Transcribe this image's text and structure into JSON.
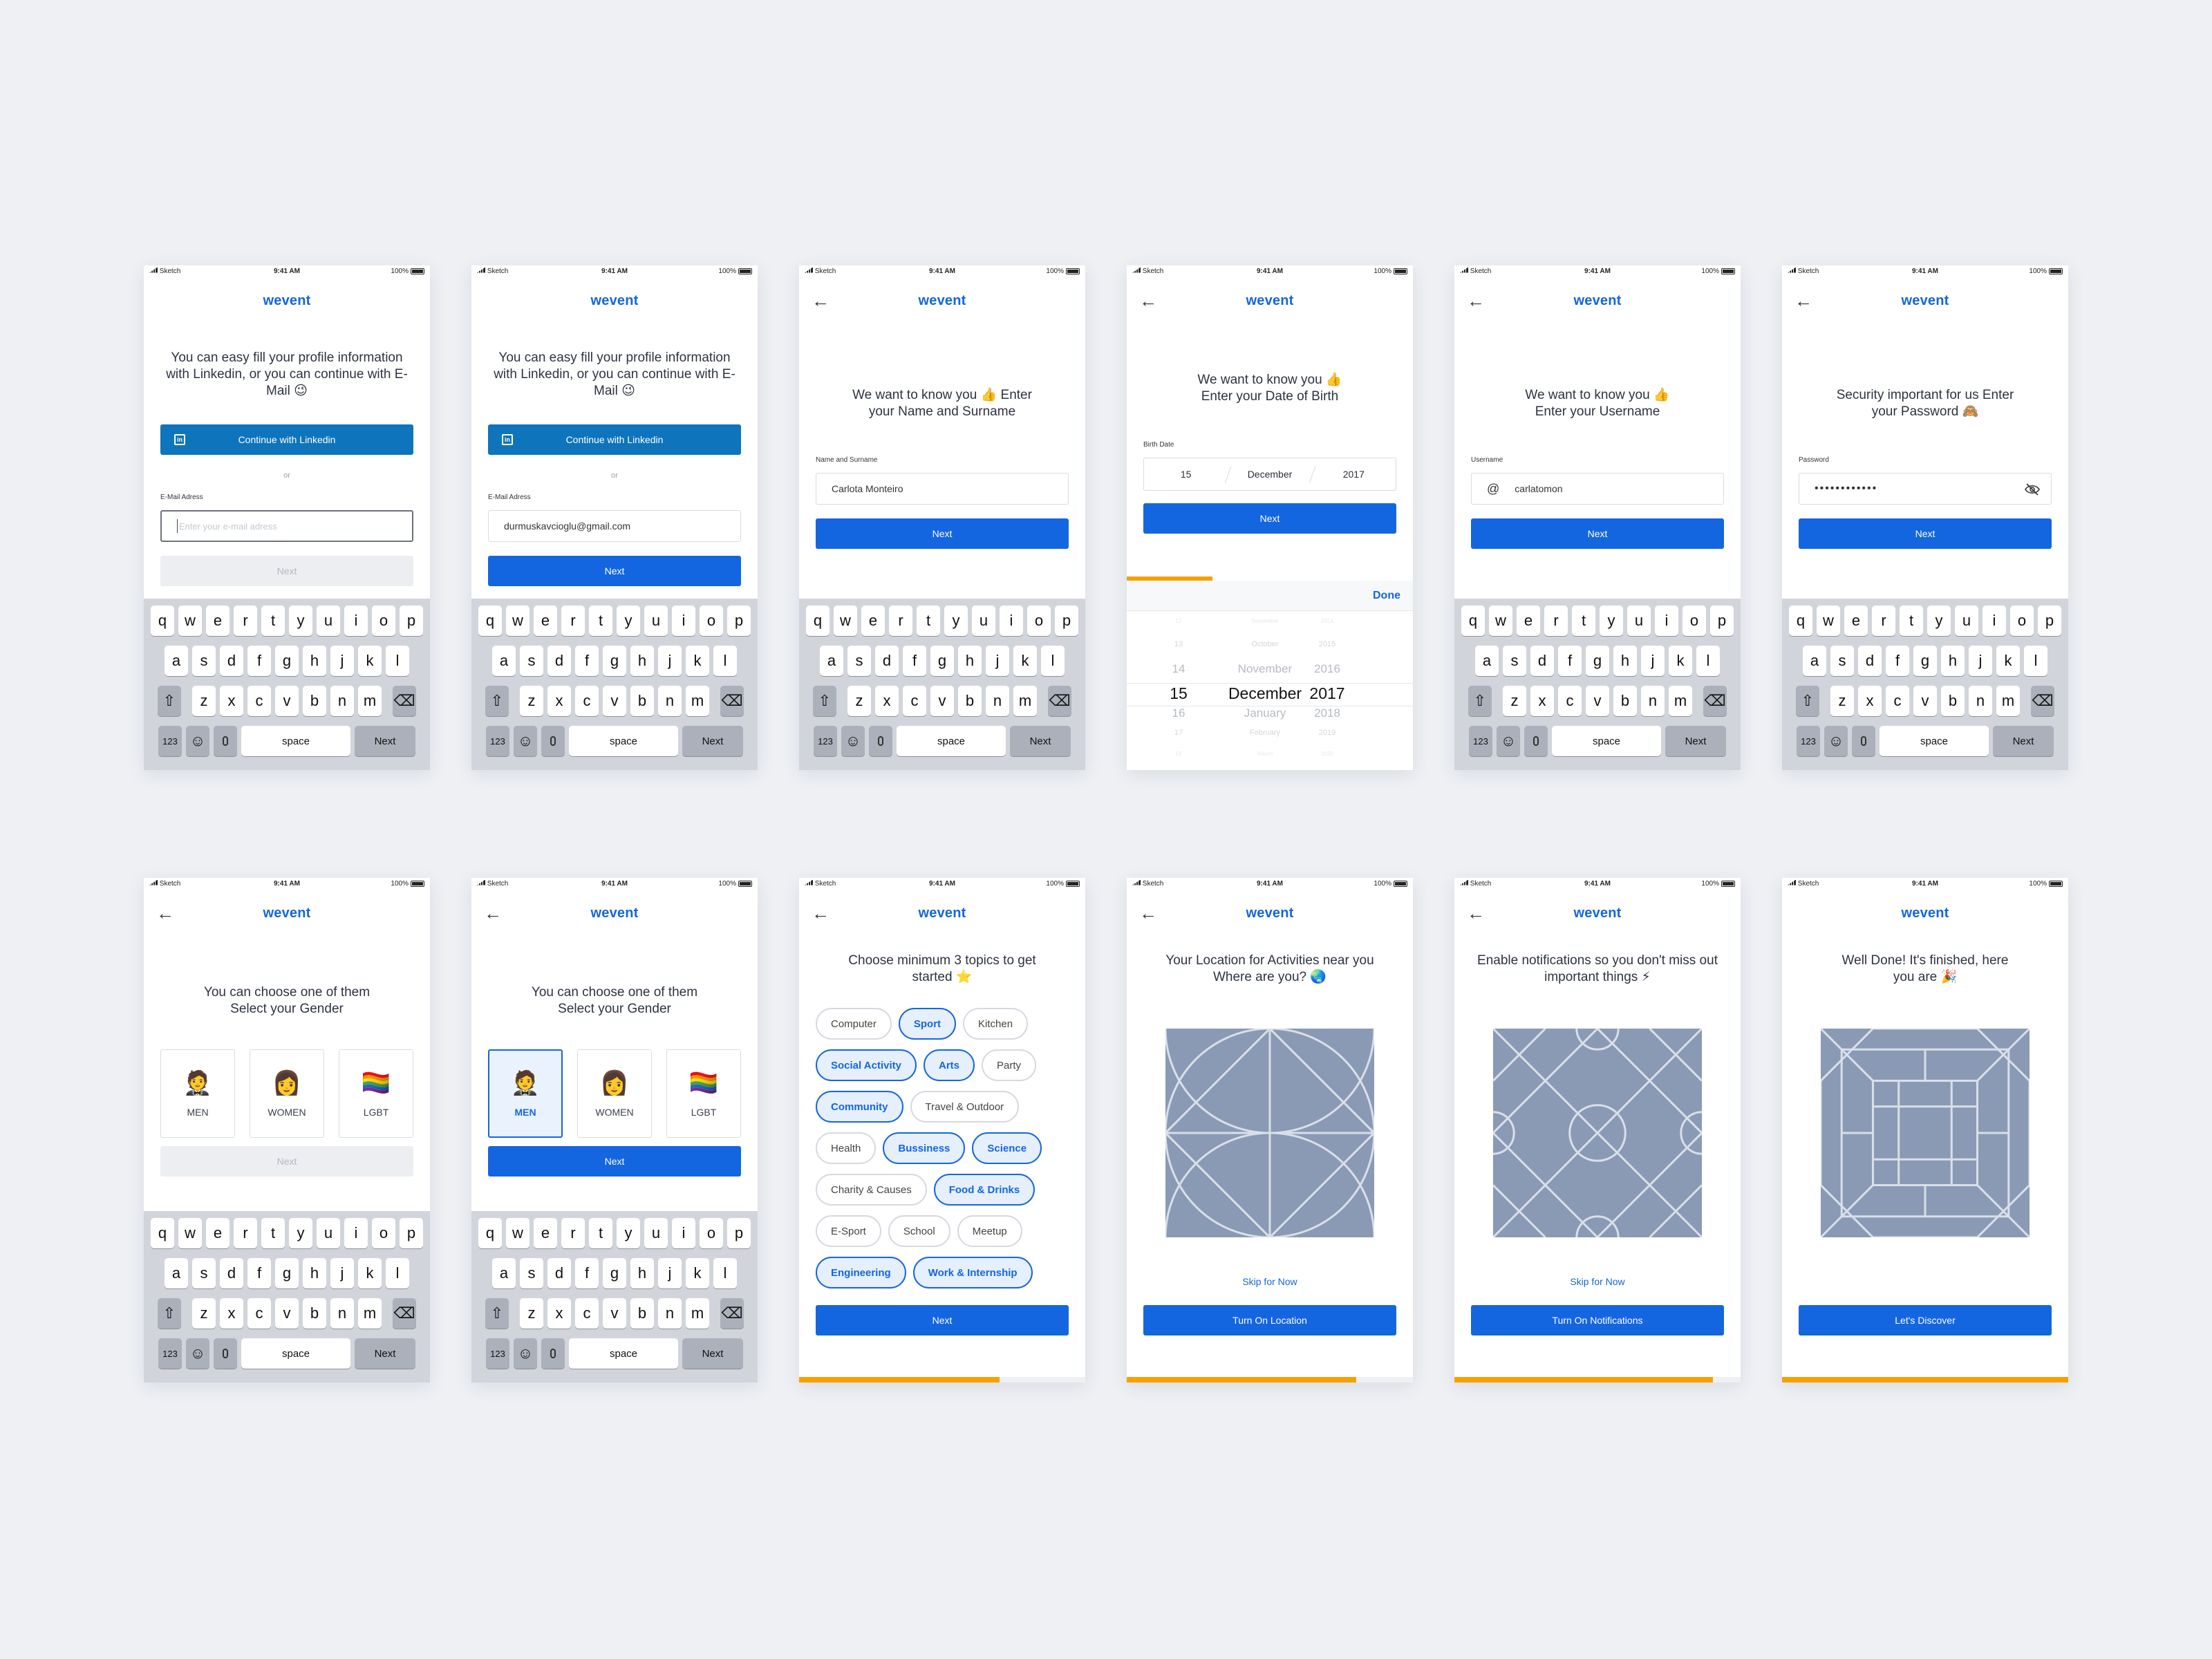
{
  "app": {
    "logo": "wevent"
  },
  "status": {
    "carrier": "Sketch",
    "time": "9:41 AM",
    "battery": "100%"
  },
  "common": {
    "back_icon": "arrow-left-icon",
    "next": "Next",
    "kb_next": "Next",
    "space": "space",
    "num": "123",
    "emoji": "☺"
  },
  "keyboard": {
    "row1": [
      "q",
      "w",
      "e",
      "r",
      "t",
      "y",
      "u",
      "i",
      "o",
      "p"
    ],
    "row2": [
      "a",
      "s",
      "d",
      "f",
      "g",
      "h",
      "j",
      "k",
      "l"
    ],
    "row3": [
      "z",
      "x",
      "c",
      "v",
      "b",
      "n",
      "m"
    ],
    "shift_icon": "shift-icon",
    "delete_icon": "delete-icon"
  },
  "s1": {
    "title": "You can easy fill your profile information with Linkedin, or you can continue with E-Mail 😉",
    "linkedin_button": "Continue with Linkedin",
    "linkedin_glyph": "in",
    "or": "or",
    "email_label": "E-Mail Adress",
    "email_placeholder": "Enter your e-mail adress"
  },
  "s2": {
    "email_value": "durmuskavcioglu@gmail.com"
  },
  "s3": {
    "title": "We want to know you 👍 Enter your Name and Surname",
    "label": "Name and Surname",
    "value": "Carlota Monteiro"
  },
  "s4": {
    "title": "We want to know you 👍 Enter your Date of Birth",
    "label": "Birth Date",
    "day": "15",
    "month": "December",
    "year": "2017",
    "done": "Done",
    "picker": {
      "days": [
        "12",
        "13",
        "14",
        "15",
        "16",
        "17",
        "18"
      ],
      "months": [
        "September",
        "October",
        "November",
        "December",
        "January",
        "February",
        "March"
      ],
      "years": [
        "2014",
        "2015",
        "2016",
        "2017",
        "2018",
        "2019",
        "2020"
      ]
    }
  },
  "s5": {
    "title": "We want to know you 👍 Enter your Username",
    "label": "Username",
    "at": "@",
    "value": "carlatomon"
  },
  "s6": {
    "title": "Security important for us Enter your Password 🙈",
    "label": "Password",
    "value": "••••••••••••",
    "eye_icon": "eye-off-icon"
  },
  "s7": {
    "title": "You can choose one of them Select your Gender",
    "men": "MEN",
    "women": "WOMEN",
    "lgbt": "LGBT",
    "men_emoji": "🤵",
    "women_emoji": "👩",
    "lgbt_emoji": "🏳️‍🌈"
  },
  "s9": {
    "title": "Choose minimum 3 topics to get started ⭐",
    "rows": [
      [
        {
          "t": "Computer",
          "on": false
        },
        {
          "t": "Sport",
          "on": true
        },
        {
          "t": "Kitchen",
          "on": false
        }
      ],
      [
        {
          "t": "Social Activity",
          "on": true
        },
        {
          "t": "Arts",
          "on": true
        },
        {
          "t": "Party",
          "on": false
        }
      ],
      [
        {
          "t": "Community",
          "on": true
        },
        {
          "t": "Travel & Outdoor",
          "on": false
        }
      ],
      [
        {
          "t": "Health",
          "on": false
        },
        {
          "t": "Bussiness",
          "on": true
        },
        {
          "t": "Science",
          "on": true
        }
      ],
      [
        {
          "t": "Charity & Causes",
          "on": false
        },
        {
          "t": "Food & Drinks",
          "on": true
        }
      ],
      [
        {
          "t": "E-Sport",
          "on": false
        },
        {
          "t": "School",
          "on": false
        },
        {
          "t": "Meetup",
          "on": false
        }
      ],
      [
        {
          "t": "Engineering",
          "on": true
        },
        {
          "t": "Work & Internship",
          "on": true
        }
      ]
    ]
  },
  "s10": {
    "title": "Your Location for Activities near you Where are you? 🌏",
    "skip": "Skip for Now",
    "button": "Turn On Location"
  },
  "s11": {
    "title": "Enable notifications so you don't miss out important things ⚡",
    "skip": "Skip for Now",
    "button": "Turn On Notifications"
  },
  "s12": {
    "title": "Well Done! It's finished, here you are 🎉",
    "button": "Let's Discover"
  },
  "progress": {
    "s1": 0.05,
    "s2": 0.1,
    "s3": 0.2,
    "s4": 0.3,
    "s5": 0.4,
    "s6": 0.5,
    "s7": 0.6,
    "s8": 0.6,
    "s9": 0.7,
    "s10": 0.8,
    "s11": 0.9,
    "s12": 1.0
  },
  "colors": {
    "accent": "#1466e0",
    "progress": "#f5a200",
    "linkedin": "#0e74bb",
    "illustration": "#8a9ab4"
  }
}
